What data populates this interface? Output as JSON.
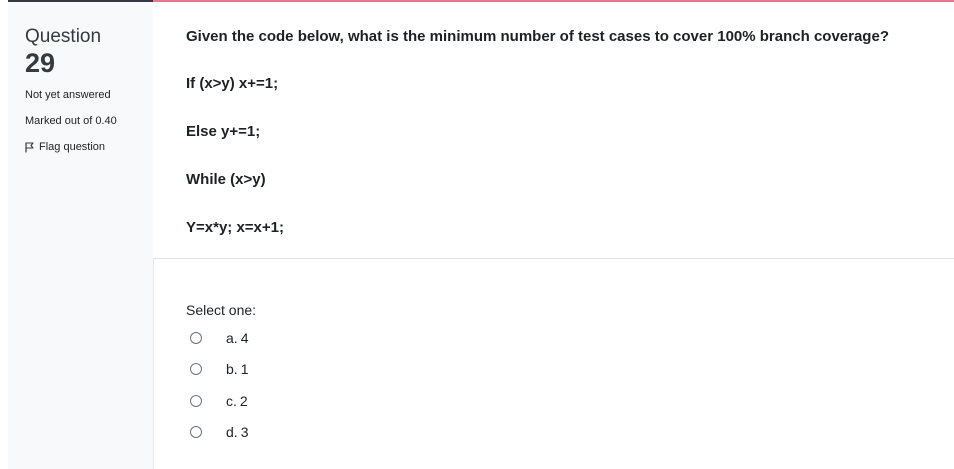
{
  "info": {
    "question_label": "Question",
    "question_number": "29",
    "state": "Not yet answered",
    "grade": "Marked out of 0.40",
    "flag_label": "Flag question"
  },
  "question": {
    "text": "Given the code below, what is the minimum number of test cases to cover 100% branch coverage?",
    "code_lines": [
      "If (x>y) x+=1;",
      "Else y+=1;",
      "While (x>y)",
      "Y=x*y; x=x+1;"
    ]
  },
  "answer": {
    "prompt": "Select one:",
    "options": [
      {
        "letter": "a.",
        "text": "4"
      },
      {
        "letter": "b.",
        "text": "1"
      },
      {
        "letter": "c.",
        "text": "2"
      },
      {
        "letter": "d.",
        "text": "3"
      }
    ]
  },
  "colors": {
    "accent_border": "#e8768d",
    "info_border": "#343a40",
    "info_background": "#f8f9fa"
  },
  "icons": {
    "flag": "flag-icon",
    "radio": "radio-button"
  }
}
